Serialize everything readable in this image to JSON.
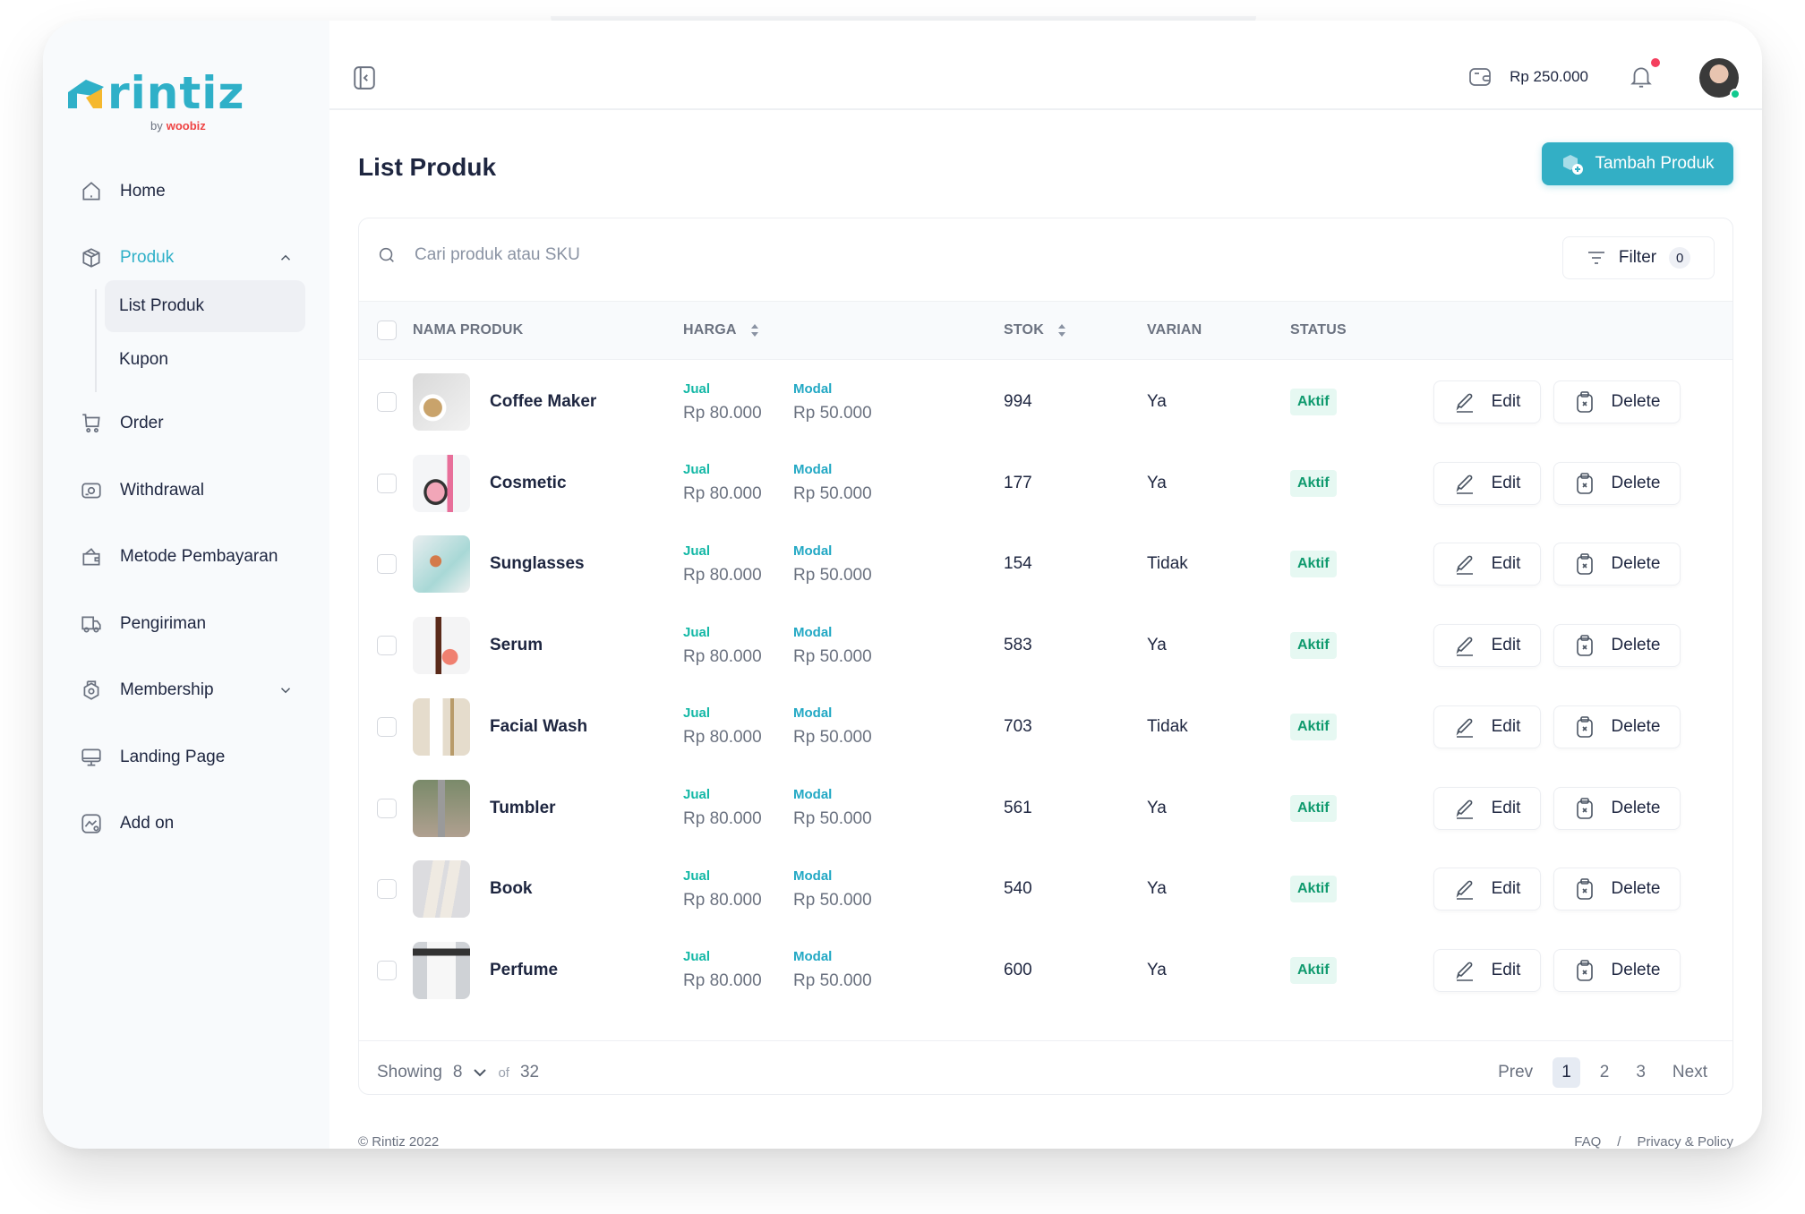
{
  "brand": {
    "name": "rintiz",
    "by_label": "by",
    "parent_brand": "woobiz",
    "colors": {
      "primary": "#33afc5",
      "accent_yellow": "#f5b82e",
      "parent_red": "#ef4444"
    }
  },
  "sidebar": {
    "items": [
      {
        "label": "Home",
        "icon": "home-icon"
      },
      {
        "label": "Produk",
        "icon": "box-icon",
        "active": true,
        "expanded": true,
        "children": [
          {
            "label": "List Produk",
            "active": true
          },
          {
            "label": "Kupon"
          }
        ]
      },
      {
        "label": "Order",
        "icon": "cart-icon"
      },
      {
        "label": "Withdrawal",
        "icon": "withdraw-icon"
      },
      {
        "label": "Metode Pembayaran",
        "icon": "wallet-icon"
      },
      {
        "label": "Pengiriman",
        "icon": "truck-icon"
      },
      {
        "label": "Membership",
        "icon": "membership-icon",
        "expanded": false
      },
      {
        "label": "Landing Page",
        "icon": "monitor-icon"
      },
      {
        "label": "Add on",
        "icon": "addon-icon"
      }
    ]
  },
  "topbar": {
    "balance": "Rp 250.000",
    "notifications_unread": true,
    "user_online": true
  },
  "page": {
    "title": "List Produk",
    "add_button": "Tambah Produk"
  },
  "search": {
    "placeholder": "Cari produk atau SKU",
    "value": ""
  },
  "filter": {
    "label": "Filter",
    "count": "0"
  },
  "table": {
    "columns": [
      "NAMA PRODUK",
      "HARGA",
      "STOK",
      "VARIAN",
      "STATUS"
    ],
    "price_labels": {
      "sell": "Jual",
      "cost": "Modal"
    },
    "action_labels": {
      "edit": "Edit",
      "delete": "Delete"
    },
    "rows": [
      {
        "name": "Coffee Maker",
        "sell": "Rp 80.000",
        "cost": "Rp 50.000",
        "stock": "994",
        "variant": "Ya",
        "status": "Aktif",
        "thumb": "coffee"
      },
      {
        "name": "Cosmetic",
        "sell": "Rp 80.000",
        "cost": "Rp 50.000",
        "stock": "177",
        "variant": "Ya",
        "status": "Aktif",
        "thumb": "cosmetic"
      },
      {
        "name": "Sunglasses",
        "sell": "Rp 80.000",
        "cost": "Rp 50.000",
        "stock": "154",
        "variant": "Tidak",
        "status": "Aktif",
        "thumb": "sunglasses"
      },
      {
        "name": "Serum",
        "sell": "Rp 80.000",
        "cost": "Rp 50.000",
        "stock": "583",
        "variant": "Ya",
        "status": "Aktif",
        "thumb": "serum"
      },
      {
        "name": "Facial Wash",
        "sell": "Rp 80.000",
        "cost": "Rp 50.000",
        "stock": "703",
        "variant": "Tidak",
        "status": "Aktif",
        "thumb": "facialwash"
      },
      {
        "name": "Tumbler",
        "sell": "Rp 80.000",
        "cost": "Rp 50.000",
        "stock": "561",
        "variant": "Ya",
        "status": "Aktif",
        "thumb": "tumbler"
      },
      {
        "name": "Book",
        "sell": "Rp 80.000",
        "cost": "Rp 50.000",
        "stock": "540",
        "variant": "Ya",
        "status": "Aktif",
        "thumb": "book"
      },
      {
        "name": "Perfume",
        "sell": "Rp 80.000",
        "cost": "Rp 50.000",
        "stock": "600",
        "variant": "Ya",
        "status": "Aktif",
        "thumb": "perfume"
      }
    ]
  },
  "pagination": {
    "showing_label": "Showing",
    "per_page": "8",
    "of_label": "of",
    "total": "32",
    "prev": "Prev",
    "next": "Next",
    "pages": [
      "1",
      "2",
      "3"
    ],
    "current": "1"
  },
  "footer": {
    "copyright": "© Rintiz 2022",
    "links": [
      "FAQ",
      "/",
      "Privacy & Policy"
    ]
  }
}
